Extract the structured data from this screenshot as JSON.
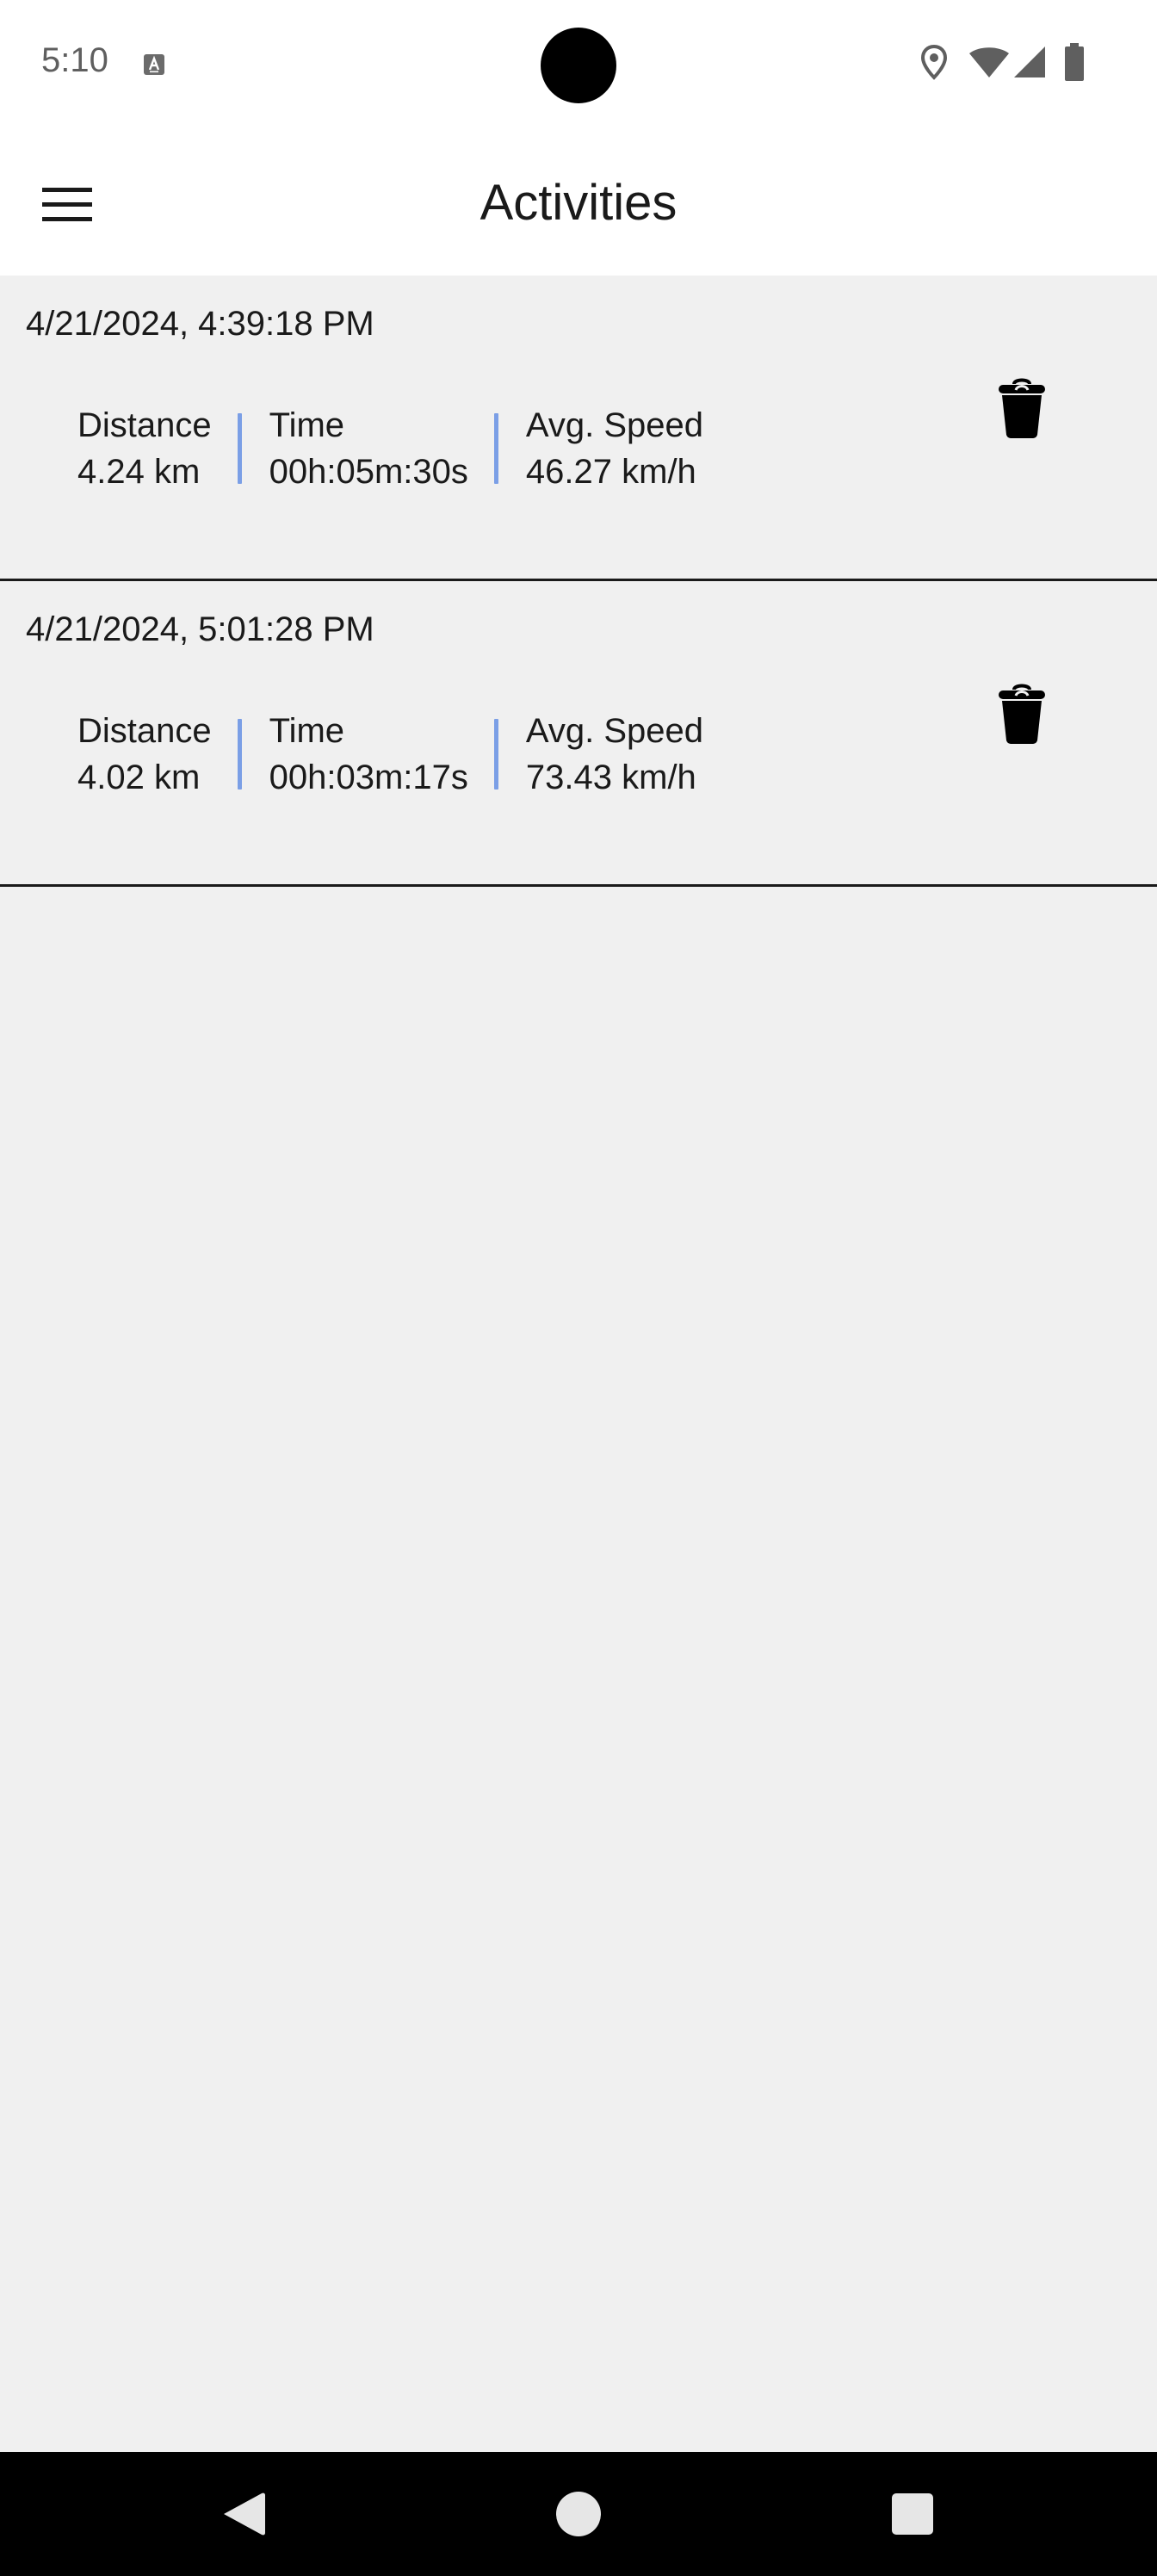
{
  "status_bar": {
    "time": "5:10",
    "icons": [
      "keyboard-a-icon",
      "location-pin-icon",
      "wifi-icon",
      "cell-signal-icon",
      "battery-icon"
    ]
  },
  "app_bar": {
    "title": "Activities",
    "menu_icon": "hamburger-menu-icon"
  },
  "activities": [
    {
      "date": "4/21/2024, 4:39:18 PM",
      "distance_label": "Distance",
      "distance": "4.24 km",
      "time_label": "Time",
      "time": "00h:05m:30s",
      "speed_label": "Avg. Speed",
      "speed": "46.27 km/h",
      "delete_icon": "trash-icon"
    },
    {
      "date": "4/21/2024, 5:01:28 PM",
      "distance_label": "Distance",
      "distance": "4.02 km",
      "time_label": "Time",
      "time": "00h:03m:17s",
      "speed_label": "Avg. Speed",
      "speed": "73.43 km/h",
      "delete_icon": "trash-icon"
    }
  ],
  "nav_bar": {
    "buttons": [
      "back-icon",
      "home-icon",
      "recents-icon"
    ]
  },
  "colors": {
    "background": "#f0f0f0",
    "app_bar": "#ffffff",
    "divider_accent": "#7b9fe6",
    "separator": "#1a1a1a",
    "nav_bar": "#000000"
  }
}
